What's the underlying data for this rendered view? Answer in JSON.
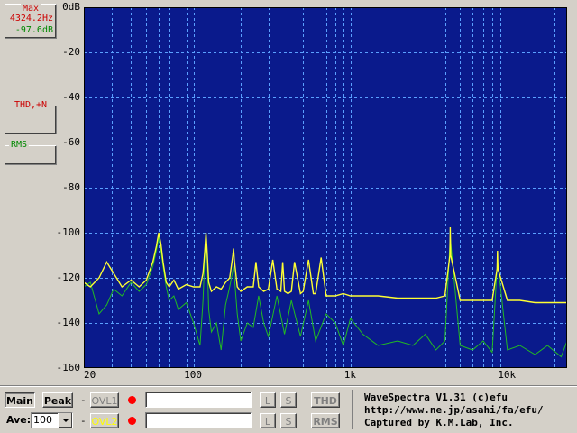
{
  "window_title": "WaveSpectra",
  "left_panel": {
    "max": {
      "title": "Max",
      "freq": "4324.2Hz",
      "level": "-97.6dB"
    },
    "thd": {
      "title": "THD,+N"
    },
    "rms": {
      "title": "RMS"
    }
  },
  "controls": {
    "main_label": "Main",
    "peak_label": "Peak",
    "ave_label": "Ave:",
    "ave_value": "100",
    "ovl1_label": "OVL1",
    "ovl2_label": "OVL2",
    "l_label": "L",
    "s_label": "S",
    "thd_label": "THD",
    "rms_label": "RMS",
    "dash": "-"
  },
  "credits": {
    "line1": "WaveSpectra V1.31 (c)efu",
    "line2": "http://www.ne.jp/asahi/fa/efu/",
    "line3": "Captured by K.M.Lab, Inc."
  },
  "colors": {
    "plot_bg": "#0a1a8c",
    "grid": "#5aa0ff",
    "main_trace": "#ffff33",
    "overlay_trace": "#22bb22",
    "max_text": "#cc0000",
    "rms_text": "#008800"
  },
  "chart_data": {
    "type": "line",
    "xscale": "log",
    "xlim": [
      20,
      24000
    ],
    "ylim": [
      -160,
      0
    ],
    "ylabel_unit": "dB",
    "x_ticks": [
      {
        "value": 20,
        "label": "20"
      },
      {
        "value": 100,
        "label": "100"
      },
      {
        "value": 1000,
        "label": "1k"
      },
      {
        "value": 10000,
        "label": "10k"
      }
    ],
    "y_ticks": [
      {
        "value": 0,
        "label": "0dB"
      },
      {
        "value": -20,
        "label": "-20"
      },
      {
        "value": -40,
        "label": "-40"
      },
      {
        "value": -60,
        "label": "-60"
      },
      {
        "value": -80,
        "label": "-80"
      },
      {
        "value": -100,
        "label": "-100"
      },
      {
        "value": -120,
        "label": "-120"
      },
      {
        "value": -140,
        "label": "-140"
      },
      {
        "value": -160,
        "label": "-160"
      }
    ],
    "series": [
      {
        "role": "main",
        "color": "#ffff33",
        "x": [
          20,
          22,
          25,
          28,
          31,
          35,
          40,
          45,
          50,
          55,
          58,
          60,
          62,
          64,
          67,
          70,
          75,
          80,
          90,
          100,
          110,
          115,
          118,
          120,
          122,
          125,
          130,
          140,
          150,
          160,
          170,
          178,
          180,
          182,
          190,
          200,
          220,
          240,
          250,
          260,
          280,
          300,
          320,
          340,
          360,
          370,
          380,
          400,
          420,
          440,
          480,
          500,
          540,
          580,
          600,
          650,
          700,
          800,
          900,
          1000,
          1200,
          1500,
          2000,
          2500,
          3000,
          3500,
          4000,
          4300,
          4324,
          4350,
          5000,
          6000,
          7000,
          8000,
          8600,
          8648,
          8700,
          10000,
          12000,
          15000,
          18000,
          22000,
          24000
        ],
        "y": [
          -122,
          -124,
          -120,
          -113,
          -118,
          -124,
          -121,
          -124,
          -121,
          -113,
          -106,
          -100,
          -105,
          -113,
          -122,
          -124,
          -121,
          -125,
          -123,
          -124,
          -124,
          -118,
          -108,
          -100,
          -108,
          -122,
          -126,
          -124,
          -125,
          -122,
          -120,
          -110,
          -107,
          -112,
          -124,
          -126,
          -124,
          -124,
          -113,
          -124,
          -126,
          -125,
          -112,
          -125,
          -126,
          -113,
          -126,
          -127,
          -126,
          -113,
          -127,
          -126,
          -112,
          -127,
          -127,
          -111,
          -128,
          -128,
          -127,
          -128,
          -128,
          -128,
          -129,
          -129,
          -129,
          -129,
          -128,
          -110,
          -97.6,
          -110,
          -130,
          -130,
          -130,
          -130,
          -116,
          -108,
          -116,
          -130,
          -130,
          -131,
          -131,
          -131,
          -131
        ]
      },
      {
        "role": "overlay",
        "color": "#22bb22",
        "x": [
          20,
          22,
          25,
          28,
          31,
          35,
          40,
          45,
          50,
          55,
          58,
          60,
          62,
          64,
          67,
          70,
          75,
          80,
          90,
          100,
          110,
          115,
          118,
          120,
          122,
          125,
          130,
          140,
          150,
          160,
          170,
          180,
          190,
          200,
          220,
          240,
          260,
          280,
          300,
          340,
          380,
          420,
          480,
          540,
          600,
          700,
          800,
          900,
          1000,
          1200,
          1500,
          2000,
          2500,
          3000,
          3500,
          4000,
          4324,
          5000,
          6000,
          7000,
          8000,
          8648,
          10000,
          12000,
          15000,
          18000,
          22000,
          24000
        ],
        "y": [
          -124,
          -122,
          -136,
          -132,
          -125,
          -128,
          -122,
          -126,
          -123,
          -115,
          -108,
          -102,
          -108,
          -115,
          -124,
          -130,
          -128,
          -134,
          -131,
          -140,
          -150,
          -130,
          -110,
          -102,
          -110,
          -134,
          -144,
          -140,
          -152,
          -132,
          -124,
          -115,
          -136,
          -148,
          -140,
          -142,
          -128,
          -140,
          -146,
          -128,
          -145,
          -130,
          -146,
          -130,
          -148,
          -136,
          -140,
          -150,
          -138,
          -145,
          -150,
          -148,
          -150,
          -145,
          -152,
          -148,
          -102,
          -150,
          -152,
          -148,
          -153,
          -112,
          -152,
          -150,
          -154,
          -150,
          -155,
          -148
        ]
      }
    ]
  }
}
